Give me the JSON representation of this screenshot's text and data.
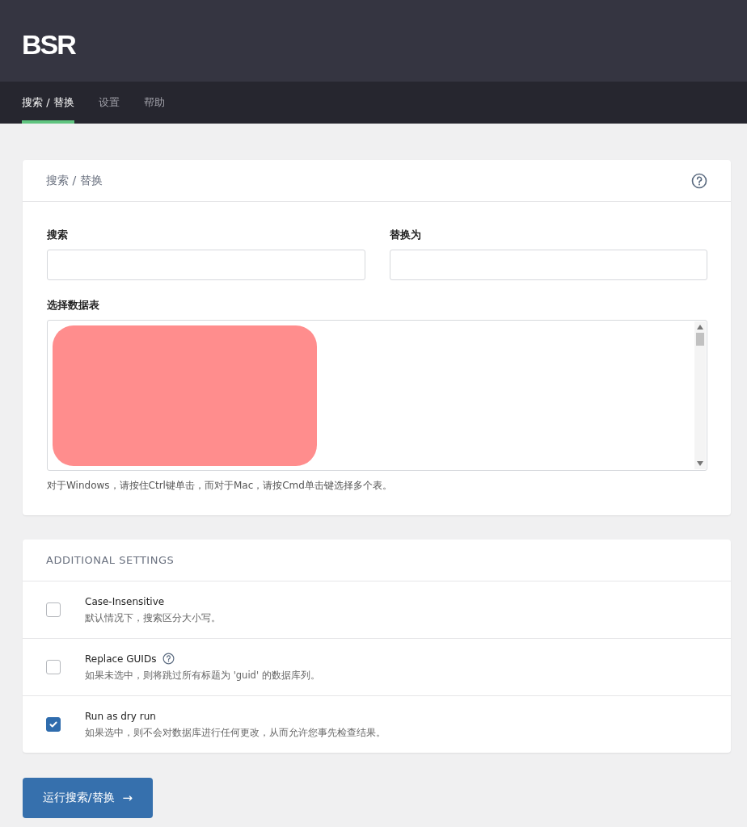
{
  "logo": "BSR",
  "tabs": [
    {
      "label": "搜索 / 替换",
      "selected": true
    },
    {
      "label": "设置",
      "selected": false
    },
    {
      "label": "帮助",
      "selected": false
    }
  ],
  "search_card": {
    "title": "搜索 / 替换",
    "fields": [
      {
        "label": "搜索"
      },
      {
        "label": "替换为"
      }
    ],
    "tables": {
      "label": "选择数据表",
      "redacted": true,
      "hint": "对于Windows，请按住Ctrl键单击，而对于Mac，请按Cmd单击键选择多个表。"
    }
  },
  "additional_settings": {
    "title": "ADDITIONAL SETTINGS",
    "options": [
      {
        "label": "Case-Insensitive",
        "help": false,
        "description": "默认情况下，搜索区分大小写。",
        "checked": false
      },
      {
        "label": "Replace GUIDs",
        "help": true,
        "description": "如果未选中，则将跳过所有标题为 'guid' 的数据库列。",
        "checked": false
      },
      {
        "label": "Run as dry run",
        "help": false,
        "description": "如果选中，则不会对数据库进行任何更改，从而允许您事先检查结果。",
        "checked": true
      }
    ]
  },
  "run_button": {
    "label": "运行搜索/替换",
    "arrow": "→"
  }
}
